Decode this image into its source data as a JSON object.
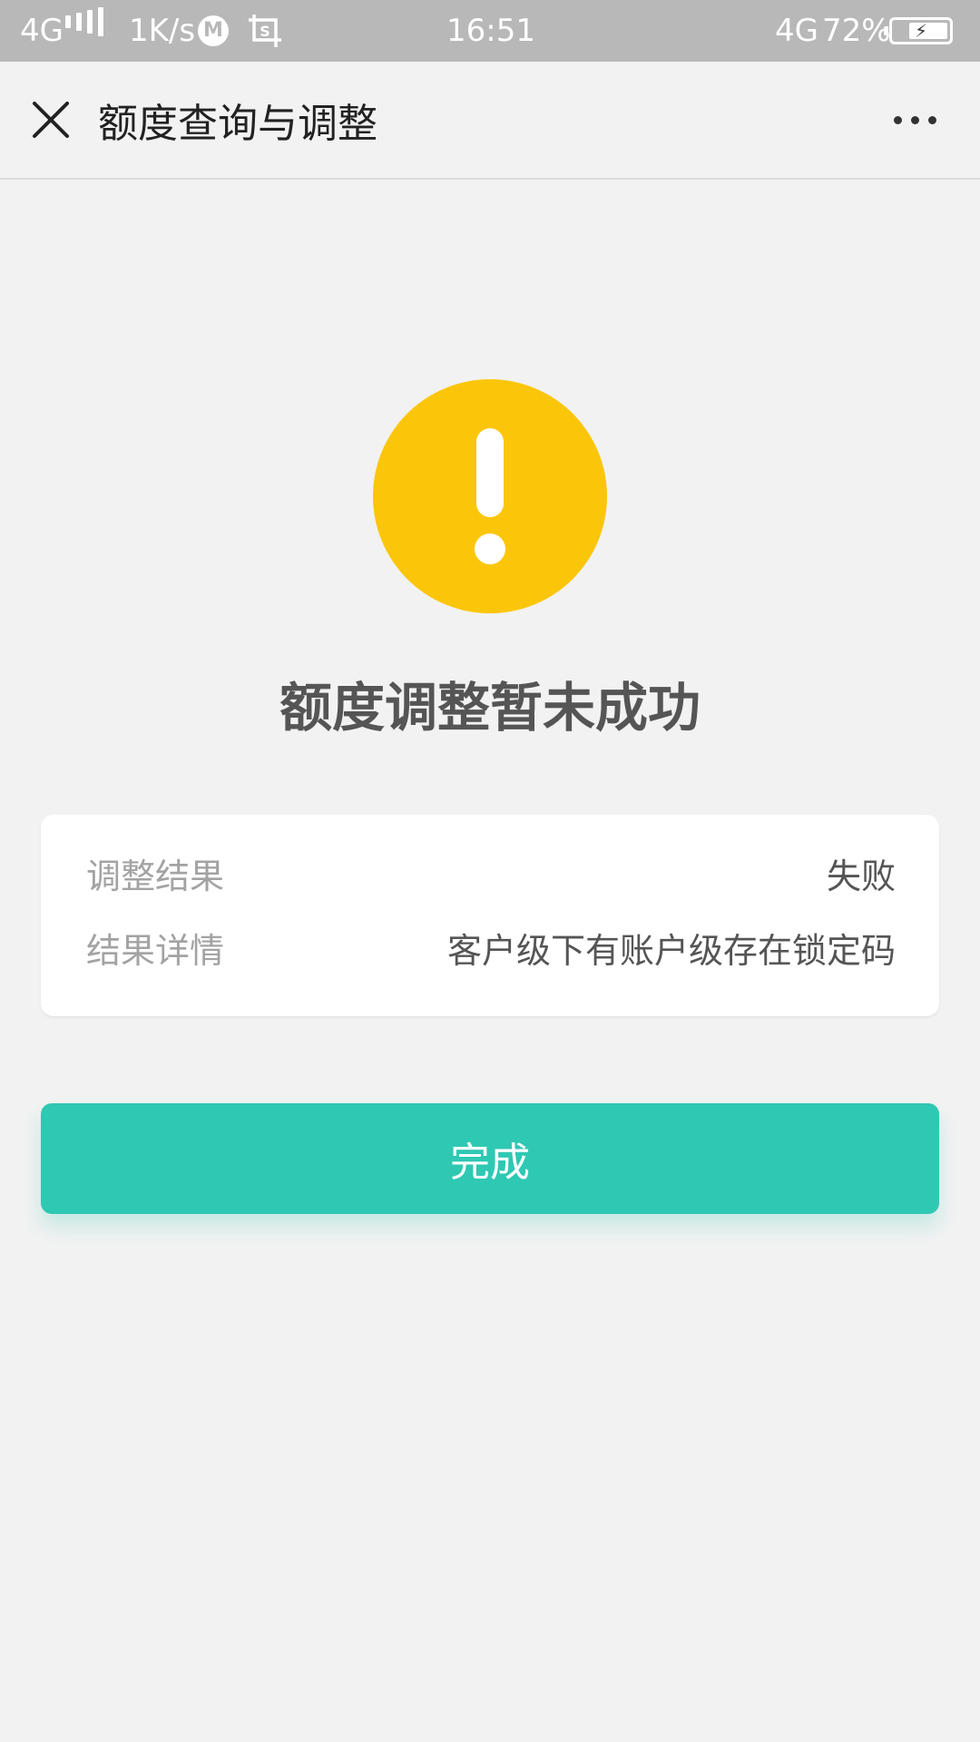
{
  "status_bar": {
    "network_left": "4G",
    "speed": "1K/s",
    "bank_glyph": "M",
    "time": "16:51",
    "network_right": "4G",
    "battery_percent": "72%",
    "battery_level": 0.72,
    "signal_icon": "signal-bars-icon",
    "crop_icon": "screenshot-icon",
    "battery_icon": "battery-charging-icon"
  },
  "header": {
    "title": "额度查询与调整",
    "close_icon": "close-icon",
    "more_icon": "more-dots-icon"
  },
  "result": {
    "icon": "warning-icon",
    "icon_color": "#fbc60a",
    "title": "额度调整暂未成功"
  },
  "details": {
    "rows": [
      {
        "label": "调整结果",
        "value": "失败"
      },
      {
        "label": "结果详情",
        "value": "客户级下有账户级存在锁定码"
      }
    ]
  },
  "actions": {
    "done_label": "完成",
    "done_color": "#2fc8b3"
  }
}
